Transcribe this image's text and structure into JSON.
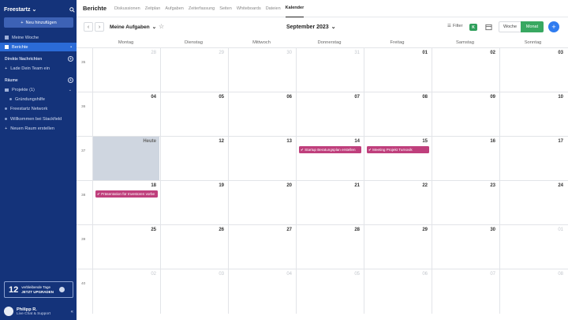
{
  "sidebar": {
    "brand": "Freestartz",
    "add_button": "Neu hinzufügen",
    "items": [
      {
        "label": "Meine Woche"
      },
      {
        "label": "Berichte"
      }
    ],
    "dm_section": "Direkte Nachrichten",
    "dm_invite": "Lade Dein Team ein",
    "rooms_section": "Räume",
    "rooms": [
      {
        "label": "Projekte (1)"
      },
      {
        "label": "Gründungshilfe"
      },
      {
        "label": "Freestartz Network"
      },
      {
        "label": "Willkommen bei Stackfield"
      },
      {
        "label": "Neuen Raum erstellen"
      }
    ],
    "trial": {
      "days": "12",
      "line1": "verbleibende Tage",
      "line2": "JETZT UPGRADEN"
    },
    "user": {
      "name": "Philipp R.",
      "sub": "Live Chat & Support"
    }
  },
  "header": {
    "title": "Berichte",
    "tabs": [
      "Diskussionen",
      "Zeitplan",
      "Aufgaben",
      "Zeiterfassung",
      "Seiten",
      "Whiteboards",
      "Dateien",
      "Kalender"
    ],
    "active_tab": "Kalender"
  },
  "toolbar": {
    "view_label": "Meine Aufgaben",
    "month_label": "September 2023",
    "filter_label": "Filter",
    "filter_badge": "K",
    "week_label": "Woche",
    "month_button": "Monat",
    "add": "+"
  },
  "calendar": {
    "weekdays": [
      "Montag",
      "Dienstag",
      "Mittwoch",
      "Donnerstag",
      "Freitag",
      "Samstag",
      "Sonntag"
    ],
    "weeks": [
      {
        "num": "35",
        "days": [
          {
            "d": "28",
            "other": true
          },
          {
            "d": "29",
            "other": true
          },
          {
            "d": "30",
            "other": true
          },
          {
            "d": "31",
            "other": true
          },
          {
            "d": "01"
          },
          {
            "d": "02"
          },
          {
            "d": "03"
          }
        ]
      },
      {
        "num": "36",
        "days": [
          {
            "d": "04"
          },
          {
            "d": "05"
          },
          {
            "d": "06"
          },
          {
            "d": "07"
          },
          {
            "d": "08"
          },
          {
            "d": "09"
          },
          {
            "d": "10"
          }
        ]
      },
      {
        "num": "37",
        "days": [
          {
            "d": "Heute",
            "today": true
          },
          {
            "d": "12"
          },
          {
            "d": "13"
          },
          {
            "d": "14",
            "event": "Startup Beratungsplan erstellen"
          },
          {
            "d": "15",
            "event": "Meeting Projekt Turnovik"
          },
          {
            "d": "16"
          },
          {
            "d": "17"
          }
        ]
      },
      {
        "num": "38",
        "days": [
          {
            "d": "18",
            "event": "Präsentation für Investoren vorbe"
          },
          {
            "d": "19"
          },
          {
            "d": "20"
          },
          {
            "d": "21"
          },
          {
            "d": "22"
          },
          {
            "d": "23"
          },
          {
            "d": "24"
          }
        ]
      },
      {
        "num": "39",
        "days": [
          {
            "d": "25"
          },
          {
            "d": "26"
          },
          {
            "d": "27"
          },
          {
            "d": "28"
          },
          {
            "d": "29"
          },
          {
            "d": "30"
          },
          {
            "d": "01",
            "other": true
          }
        ]
      },
      {
        "num": "40",
        "days": [
          {
            "d": "02",
            "other": true
          },
          {
            "d": "03",
            "other": true
          },
          {
            "d": "04",
            "other": true
          },
          {
            "d": "05",
            "other": true
          },
          {
            "d": "06",
            "other": true
          },
          {
            "d": "07",
            "other": true
          },
          {
            "d": "08",
            "other": true
          }
        ]
      }
    ]
  },
  "colors": {
    "sidebar": "#14337a",
    "active": "#2b6bd7",
    "event": "#bf3f7c",
    "month_button": "#38a861"
  }
}
